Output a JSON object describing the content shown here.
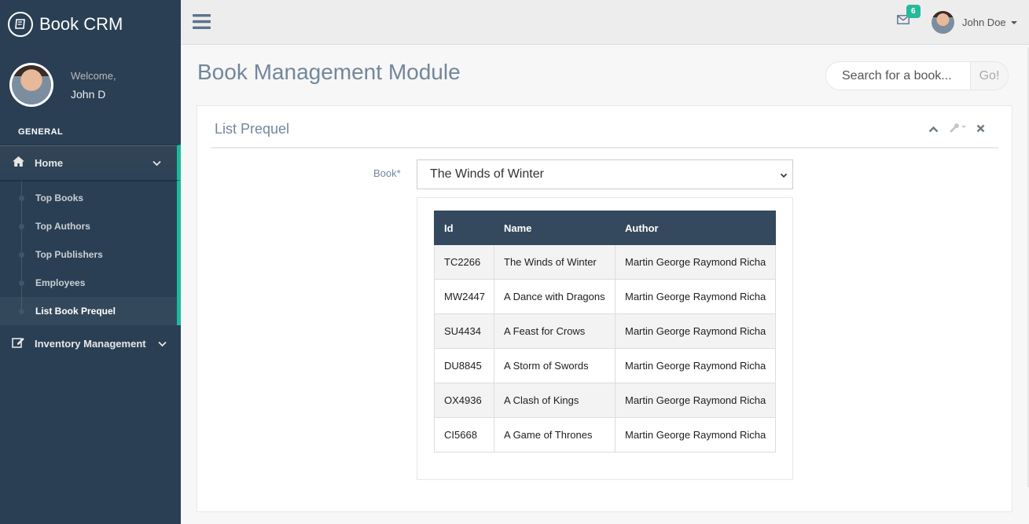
{
  "app": {
    "title": "Book CRM"
  },
  "profile": {
    "welcome": "Welcome,",
    "name": "John D"
  },
  "sidebar": {
    "section": "GENERAL",
    "home_label": "Home",
    "children": [
      {
        "label": "Top Books"
      },
      {
        "label": "Top Authors"
      },
      {
        "label": "Top Publishers"
      },
      {
        "label": "Employees"
      },
      {
        "label": "List Book Prequel"
      }
    ],
    "inventory_label": "Inventory Management"
  },
  "topnav": {
    "mail_count": "6",
    "user_name": "John Doe"
  },
  "page": {
    "title": "Book Management Module"
  },
  "search": {
    "placeholder": "Search for a book...",
    "button": "Go!"
  },
  "panel": {
    "title": "List Prequel",
    "book_label": "Book*",
    "book_selected": "The Winds of Winter",
    "columns": [
      "Id",
      "Name",
      "Author"
    ],
    "rows": [
      [
        "TC2266",
        "The Winds of Winter",
        "Martin George Raymond Richa"
      ],
      [
        "MW2447",
        "A Dance with Dragons",
        "Martin George Raymond Richa"
      ],
      [
        "SU4434",
        "A Feast for Crows",
        "Martin George Raymond Richa"
      ],
      [
        "DU8845",
        "A Storm of Swords",
        "Martin George Raymond Richa"
      ],
      [
        "OX4936",
        "A Clash of Kings",
        "Martin George Raymond Richa"
      ],
      [
        "CI5668",
        "A Game of Thrones",
        "Martin George Raymond Richa"
      ]
    ]
  },
  "colors": {
    "sidebar": "#2a3f54",
    "accent": "#1abb9c",
    "table_header": "#34495e",
    "badge": "#26b99a"
  }
}
